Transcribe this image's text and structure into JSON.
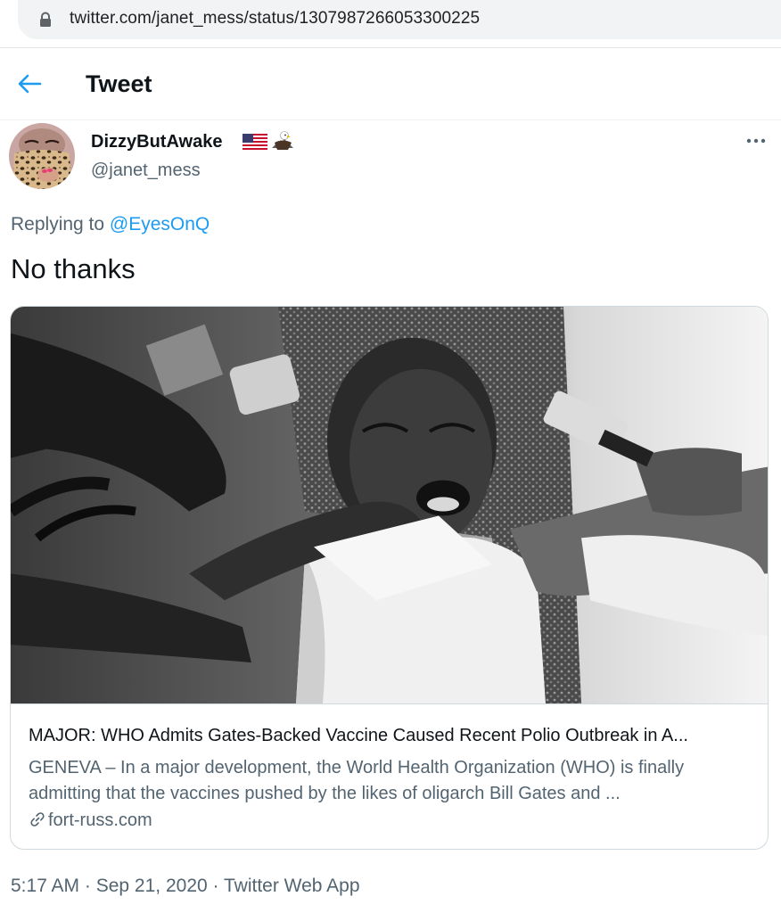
{
  "browser": {
    "url": "twitter.com/janet_mess/status/1307987266053300225",
    "icon": "lock-icon"
  },
  "header": {
    "title": "Tweet",
    "back_icon": "arrow-left-icon"
  },
  "author": {
    "display_name": "DizzyButAwake",
    "handle": "@janet_mess",
    "emojis": [
      "us-flag-icon",
      "eagle-icon"
    ]
  },
  "tweet": {
    "replying_prefix": "Replying to",
    "replying_to": "@EyesOnQ",
    "text": "No thanks"
  },
  "card": {
    "title": "MAJOR: WHO Admits Gates-Backed Vaccine Caused Recent Polio Outbreak in A...",
    "description": "GENEVA – In a major development, the World Health Organization (WHO) is finally admitting that the vaccines pushed by the likes of oligarch Bill Gates and ...",
    "domain": "fort-russ.com",
    "image_icon": "photo-vaccination-child"
  },
  "meta": {
    "time": "5:17 AM",
    "sep1": " · ",
    "date": "Sep 21, 2020",
    "sep2": " · ",
    "source": "Twitter Web App"
  },
  "colors": {
    "accent": "#1d9bf0",
    "text": "#0f1419",
    "secondary": "#536471",
    "border": "#cfd9de"
  }
}
